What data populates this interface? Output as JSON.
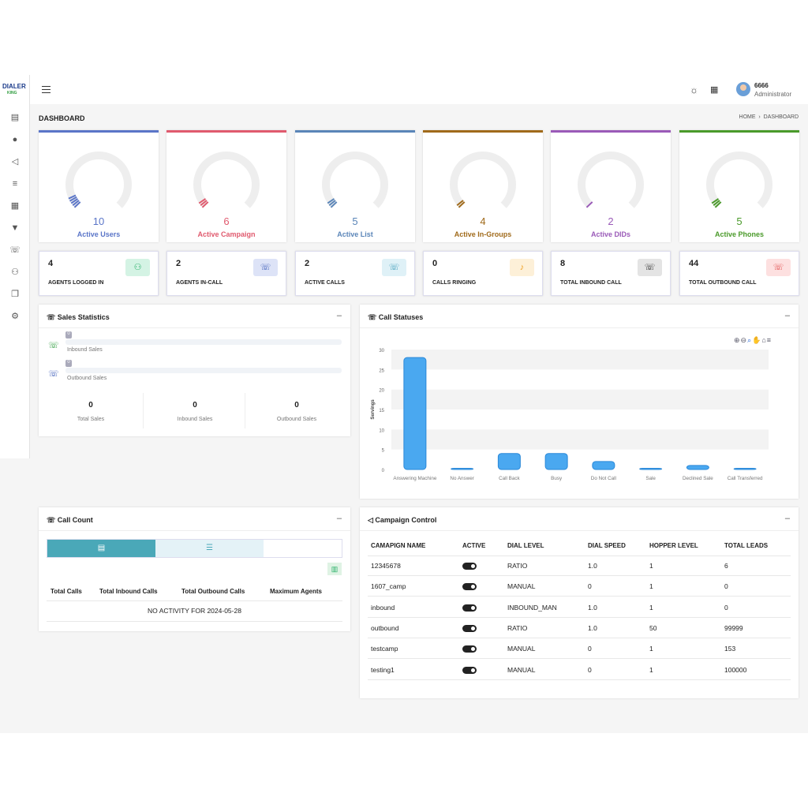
{
  "brand": {
    "logo_text": "DIALER",
    "logo_sub": "KING"
  },
  "user": {
    "name": "6666",
    "role": "Administrator"
  },
  "page": {
    "title": "DASHBOARD",
    "breadcrumb_home": "HOME",
    "breadcrumb_sep": "›",
    "breadcrumb_current": "DASHBOARD"
  },
  "sidebar": {
    "icons": [
      "reports-icon",
      "user-icon",
      "megaphone-icon",
      "list-icon",
      "document-icon",
      "filter-icon",
      "phone-icon",
      "group-icon",
      "copy-icon",
      "settings-icon"
    ]
  },
  "gauges": [
    {
      "value": "10",
      "label": "Active Users",
      "color": "#5a75c8"
    },
    {
      "value": "6",
      "label": "Active Campaign",
      "color": "#e05a6e"
    },
    {
      "value": "5",
      "label": "Active List",
      "color": "#5a85b8"
    },
    {
      "value": "4",
      "label": "Active In-Groups",
      "color": "#a06a1a"
    },
    {
      "value": "2",
      "label": "Active DIDs",
      "color": "#9a5ab8"
    },
    {
      "value": "5",
      "label": "Active Phones",
      "color": "#4a9a2a"
    }
  ],
  "stats": [
    {
      "value": "4",
      "label": "AGENTS LOGGED IN",
      "bg": "#d4f3e4",
      "fg": "#2ab06a",
      "icon": "users-icon"
    },
    {
      "value": "2",
      "label": "AGENTS IN-CALL",
      "bg": "#dde3f7",
      "fg": "#3a5ab8",
      "icon": "phone-icon"
    },
    {
      "value": "2",
      "label": "ACTIVE CALLS",
      "bg": "#dff1f7",
      "fg": "#3a9ab8",
      "icon": "phone-active-icon"
    },
    {
      "value": "0",
      "label": "CALLS RINGING",
      "bg": "#fdf0d8",
      "fg": "#f0a020",
      "icon": "bell-icon"
    },
    {
      "value": "8",
      "label": "TOTAL INBOUND CALL",
      "bg": "#e4e4e4",
      "fg": "#222",
      "icon": "inbound-call-icon"
    },
    {
      "value": "44",
      "label": "TOTAL OUTBOUND CALL",
      "bg": "#fde0e0",
      "fg": "#e04a4a",
      "icon": "outbound-call-icon"
    }
  ],
  "sales": {
    "title": "Sales Statistics",
    "inbound_label": "Inbound Sales",
    "outbound_label": "Outbound Sales",
    "inbound_badge": "0",
    "outbound_badge": "0",
    "totals": [
      {
        "value": "0",
        "label": "Total Sales"
      },
      {
        "value": "0",
        "label": "Inbound Sales"
      },
      {
        "value": "0",
        "label": "Outbound Sales"
      }
    ]
  },
  "call_statuses": {
    "title": "Call Statuses"
  },
  "chart_data": {
    "type": "bar",
    "ylabel": "Servings",
    "xlabel": "",
    "ylim": [
      0,
      30
    ],
    "yticks": [
      0,
      5,
      10,
      15,
      20,
      25,
      30
    ],
    "categories": [
      "Answering Machine",
      "No Answer",
      "Call Back",
      "Busy",
      "Do Not Call",
      "Sale",
      "Declined Sale",
      "Call Transferred"
    ],
    "values": [
      28,
      0,
      4,
      4,
      2,
      0,
      1,
      0
    ],
    "color": "#4aa8f0"
  },
  "call_count": {
    "title": "Call Count",
    "headers": [
      "Total Calls",
      "Total Inbound Calls",
      "Total Outbound Calls",
      "Maximum Agents"
    ],
    "empty": "NO ACTIVITY FOR 2024-05-28"
  },
  "campaign": {
    "title": "Campaign Control",
    "headers": [
      "CAMAPIGN NAME",
      "ACTIVE",
      "DIAL LEVEL",
      "DIAL SPEED",
      "HOPPER LEVEL",
      "TOTAL LEADS"
    ],
    "rows": [
      {
        "name": "12345678",
        "level": "RATIO",
        "speed": "1.0",
        "hopper": "1",
        "leads": "6"
      },
      {
        "name": "1607_camp",
        "level": "MANUAL",
        "speed": "0",
        "hopper": "1",
        "leads": "0"
      },
      {
        "name": "inbound",
        "level": "INBOUND_MAN",
        "speed": "1.0",
        "hopper": "1",
        "leads": "0"
      },
      {
        "name": "outbound",
        "level": "RATIO",
        "speed": "1.0",
        "hopper": "50",
        "leads": "99999"
      },
      {
        "name": "testcamp",
        "level": "MANUAL",
        "speed": "0",
        "hopper": "1",
        "leads": "153"
      },
      {
        "name": "testing1",
        "level": "MANUAL",
        "speed": "0",
        "hopper": "1",
        "leads": "100000"
      }
    ]
  }
}
